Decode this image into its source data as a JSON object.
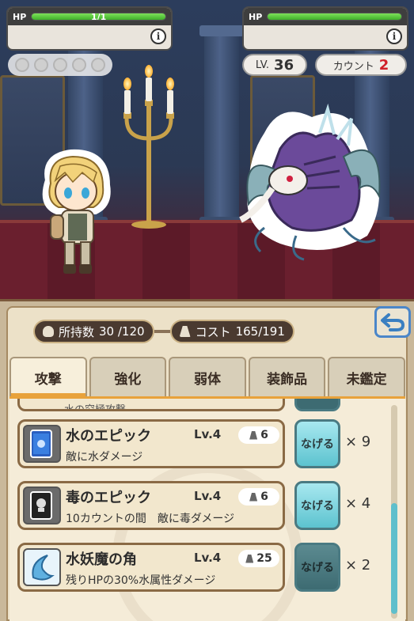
{
  "player": {
    "hp_label": "HP",
    "hp_text": "1/1",
    "hp_fraction": 1.0,
    "info_icon": "info-icon",
    "turn_dots": 5
  },
  "enemy": {
    "hp_label": "HP",
    "hp_fraction": 1.0,
    "info_icon": "info-icon",
    "level_prefix": "LV.",
    "level": "36",
    "count_label": "カウント",
    "count": "2"
  },
  "inventory": {
    "held_label": "所持数",
    "held_value": "30 /120",
    "cost_label": "コスト",
    "cost_value": "165/191",
    "back_icon": "back-arrow-icon",
    "tabs": [
      {
        "label": "攻撃",
        "active": true
      },
      {
        "label": "強化",
        "active": false
      },
      {
        "label": "弱体",
        "active": false
      },
      {
        "label": "装飾品",
        "active": false
      },
      {
        "label": "未鑑定",
        "active": false
      }
    ],
    "partial_item_name": "水の究極攻撃",
    "items": [
      {
        "name": "水のエピック",
        "level": "Lv.4",
        "cost": "6",
        "desc": "敵に水ダメージ",
        "button": "なげる",
        "qty": "× 9",
        "icon": "blue-book-icon",
        "button_enabled": true
      },
      {
        "name": "毒のエピック",
        "level": "Lv.4",
        "cost": "6",
        "desc": "10カウントの間　敵に毒ダメージ",
        "button": "なげる",
        "qty": "× 4",
        "icon": "black-book-icon",
        "button_enabled": true
      },
      {
        "name": "水妖魔の角",
        "level": "Lv.4",
        "cost": "25",
        "desc": "残りHPの30%水属性ダメージ",
        "button": "なげる",
        "qty": "× 2",
        "icon": "water-horn-icon",
        "button_enabled": false
      }
    ]
  }
}
